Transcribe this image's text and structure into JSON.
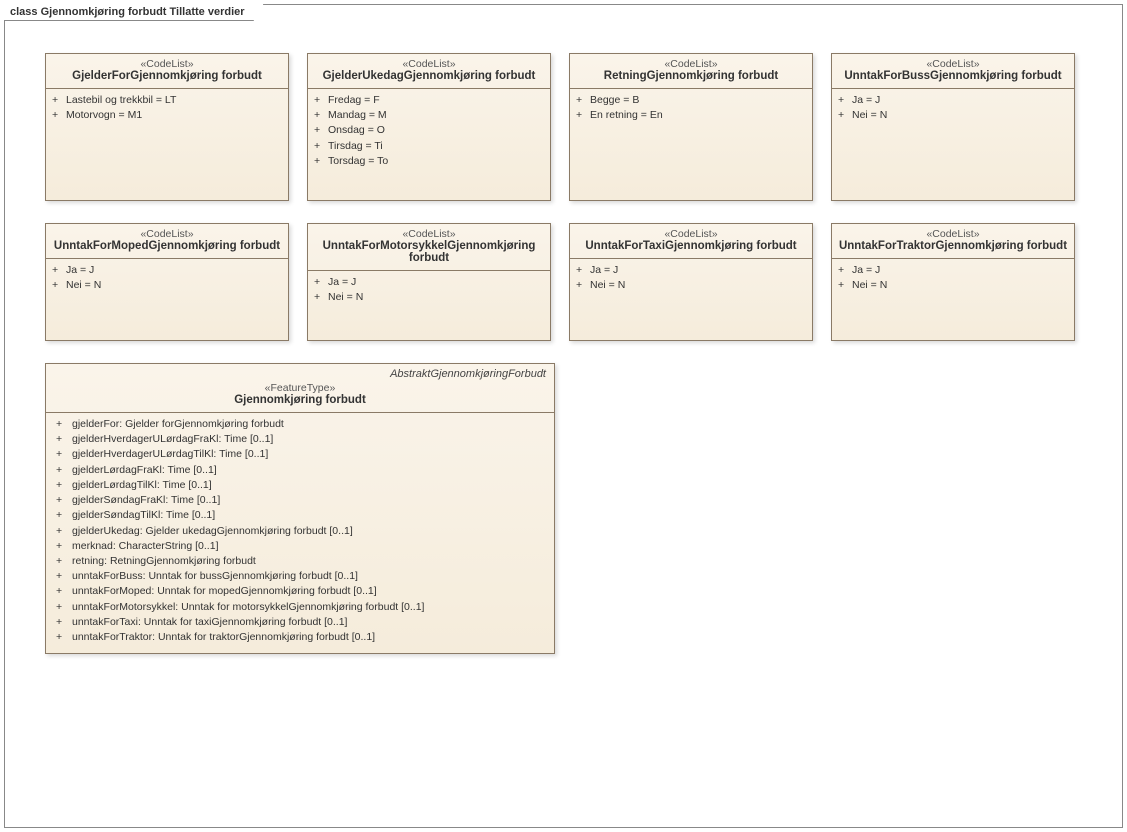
{
  "frame_label_kw": "class",
  "frame_label_name": "Gjennomkjøring forbudt Tillatte verdier",
  "codelists_row1": [
    {
      "stereo": "«CodeList»",
      "name": "GjelderForGjennomkjøring forbudt",
      "items": [
        "Lastebil og trekkbil = LT",
        "Motorvogn = M1"
      ]
    },
    {
      "stereo": "«CodeList»",
      "name": "GjelderUkedagGjennomkjøring forbudt",
      "items": [
        "Fredag = F",
        "Mandag = M",
        "Onsdag = O",
        "Tirsdag = Ti",
        "Torsdag = To"
      ]
    },
    {
      "stereo": "«CodeList»",
      "name": "RetningGjennomkjøring forbudt",
      "items": [
        "Begge = B",
        "En retning = En"
      ]
    },
    {
      "stereo": "«CodeList»",
      "name": "UnntakForBussGjennomkjøring forbudt",
      "items": [
        "Ja = J",
        "Nei = N"
      ]
    }
  ],
  "codelists_row2": [
    {
      "stereo": "«CodeList»",
      "name": "UnntakForMopedGjennomkjøring forbudt",
      "items": [
        "Ja = J",
        "Nei = N"
      ]
    },
    {
      "stereo": "«CodeList»",
      "name": "UnntakForMotorsykkelGjennomkjøring forbudt",
      "items": [
        "Ja = J",
        "Nei = N"
      ]
    },
    {
      "stereo": "«CodeList»",
      "name": "UnntakForTaxiGjennomkjøring forbudt",
      "items": [
        "Ja = J",
        "Nei = N"
      ]
    },
    {
      "stereo": "«CodeList»",
      "name": "UnntakForTraktorGjennomkjøring forbudt",
      "items": [
        "Ja = J",
        "Nei = N"
      ]
    }
  ],
  "feature": {
    "abstract_ref": "AbstraktGjennomkjøringForbudt",
    "stereo": "«FeatureType»",
    "name": "Gjennomkjøring forbudt",
    "attrs": [
      "gjelderFor: Gjelder forGjennomkjøring forbudt",
      "gjelderHverdagerULørdagFraKl: Time [0..1]",
      "gjelderHverdagerULørdagTilKl: Time [0..1]",
      "gjelderLørdagFraKl: Time [0..1]",
      "gjelderLørdagTilKl: Time [0..1]",
      "gjelderSøndagFraKl: Time [0..1]",
      "gjelderSøndagTilKl: Time [0..1]",
      "gjelderUkedag: Gjelder ukedagGjennomkjøring forbudt [0..1]",
      "merknad: CharacterString [0..1]",
      "retning: RetningGjennomkjøring forbudt",
      "unntakForBuss: Unntak for bussGjennomkjøring forbudt [0..1]",
      "unntakForMoped: Unntak for mopedGjennomkjøring forbudt [0..1]",
      "unntakForMotorsykkel: Unntak for motorsykkelGjennomkjøring forbudt [0..1]",
      "unntakForTaxi: Unntak for taxiGjennomkjøring forbudt [0..1]",
      "unntakForTraktor: Unntak for traktorGjennomkjøring forbudt [0..1]"
    ]
  }
}
